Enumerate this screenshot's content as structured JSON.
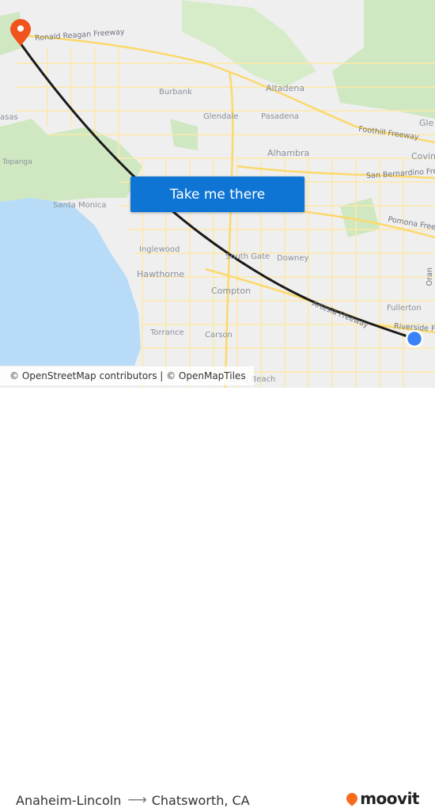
{
  "map": {
    "city_labels": [
      {
        "name": "Altadena"
      },
      {
        "name": "Burbank"
      },
      {
        "name": "Glendale"
      },
      {
        "name": "Pasadena"
      },
      {
        "name": "Alhambra"
      },
      {
        "name": "Santa Monica"
      },
      {
        "name": "Topanga"
      },
      {
        "name": "Inglewood"
      },
      {
        "name": "Hawthorne"
      },
      {
        "name": "South Gate"
      },
      {
        "name": "Downey"
      },
      {
        "name": "Compton"
      },
      {
        "name": "Torrance"
      },
      {
        "name": "Carson"
      },
      {
        "name": "Long Beach"
      },
      {
        "name": "Fullerton"
      },
      {
        "name": "Covin"
      },
      {
        "name": "Gle"
      },
      {
        "name": "asas"
      }
    ],
    "road_labels": [
      {
        "name": "Ronald Reagan Freeway"
      },
      {
        "name": "Foothill Freeway"
      },
      {
        "name": "San Bernardino Fre"
      },
      {
        "name": "Pomona Free"
      },
      {
        "name": "Artesia Freeway"
      },
      {
        "name": "Riverside Fre"
      },
      {
        "name": "Oran"
      }
    ],
    "origin_marker": {
      "name": "Anaheim-Lincoln",
      "color": "#3b82f6"
    },
    "destination_marker": {
      "name": "Chatsworth, CA",
      "color": "#f0531c"
    },
    "route_color": "#1a1a1a",
    "attribution": "© OpenStreetMap contributors | © OpenMapTiles"
  },
  "cta": {
    "label": "Take me there",
    "color": "#0f75d4"
  },
  "footer": {
    "origin": "Anaheim-Lincoln",
    "destination": "Chatsworth, CA",
    "arrow": "⟶",
    "brand": "moovit",
    "brand_color": "#f96b1c"
  }
}
